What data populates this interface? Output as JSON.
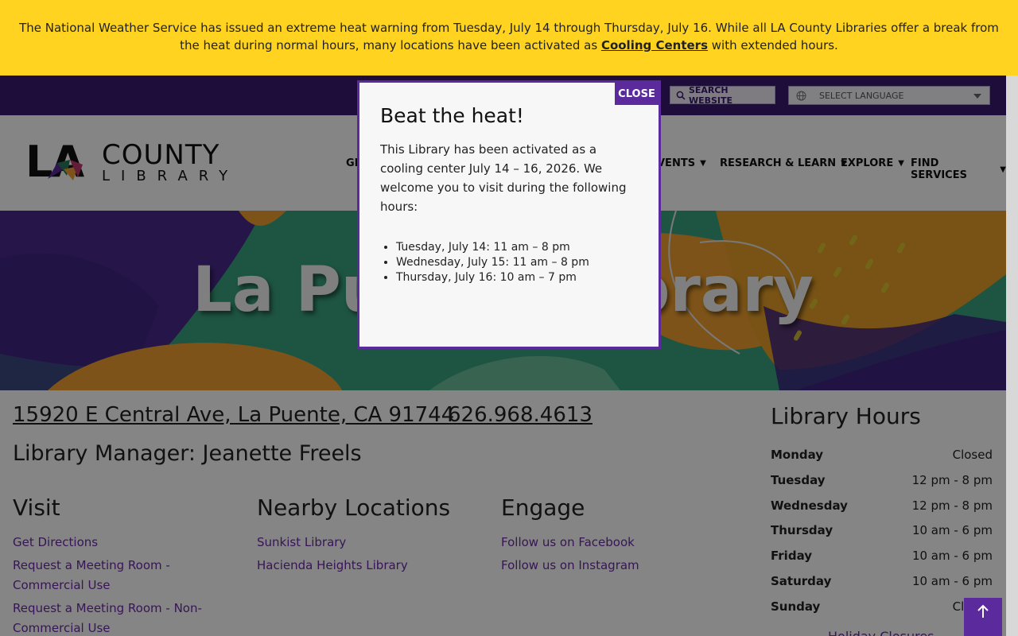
{
  "alert": {
    "text_before": "The National Weather Service has issued an extreme heat warning from Tuesday, July 14 through Thursday, July 16. While all LA County Libraries offer a break from the heat during normal hours, many locations have been activated as ",
    "link": "Cooling Centers",
    "text_after": " with extended hours."
  },
  "utility": {
    "search_label": "SEARCH WEBSITE",
    "language_label": "SELECT LANGUAGE"
  },
  "logo": {
    "la": "LA",
    "county": "COUNTY",
    "library": "LIBRARY"
  },
  "nav": {
    "items": [
      {
        "label": "GE"
      },
      {
        "label": "VENTS"
      },
      {
        "label": "RESEARCH & LEARN"
      },
      {
        "label": "EXPLORE"
      },
      {
        "label": "FIND SERVICES"
      }
    ],
    "arrow": "▼"
  },
  "hero": {
    "title": "La Puente Library"
  },
  "info": {
    "address": "15920 E Central Ave, La Puente, CA 91744",
    "phone": "626.968.4613",
    "manager": "Library Manager: Jeanette Freels"
  },
  "visit": {
    "heading": "Visit",
    "links": [
      "Get Directions",
      "Request a Meeting Room - Commercial Use",
      "Request a Meeting Room - Non-Commercial Use"
    ]
  },
  "nearby": {
    "heading": "Nearby Locations",
    "links": [
      "Sunkist Library",
      "Hacienda Heights Library"
    ]
  },
  "engage": {
    "heading": "Engage",
    "links": [
      "Follow us on Facebook",
      "Follow us on Instagram"
    ]
  },
  "hours": {
    "heading": "Library Hours",
    "rows": [
      {
        "day": "Monday",
        "time": "Closed"
      },
      {
        "day": "Tuesday",
        "time": "12 pm - 8 pm"
      },
      {
        "day": "Wednesday",
        "time": "12 pm - 8 pm"
      },
      {
        "day": "Thursday",
        "time": "10 am - 6 pm"
      },
      {
        "day": "Friday",
        "time": "10 am - 6 pm"
      },
      {
        "day": "Saturday",
        "time": "10 am - 6 pm"
      },
      {
        "day": "Sunday",
        "time": "Closed"
      }
    ],
    "holiday_link": "Holiday Closures"
  },
  "modal": {
    "close_label": "CLOSE",
    "title": "Beat the heat!",
    "body": "This Library has been activated as a cooling center July 14 – 16, 2026. We welcome you to visit during the following hours:",
    "hours": [
      "Tuesday, July 14: 11 am – 8 pm",
      "Wednesday, July 15: 11 am – 8 pm",
      "Thursday, July 16: 10 am – 7 pm"
    ]
  },
  "colors": {
    "alert_bg": "#ffd31f",
    "brand_purple": "#5b2a9c",
    "utility_bg": "#3a1a72",
    "link_purple": "#6b2aa8",
    "hero_green": "#3aa37f",
    "hero_orange": "#f0a030"
  },
  "icons": {
    "search": "search-icon",
    "language": "globe-icon",
    "scroll_top": "arrow-up-icon"
  }
}
